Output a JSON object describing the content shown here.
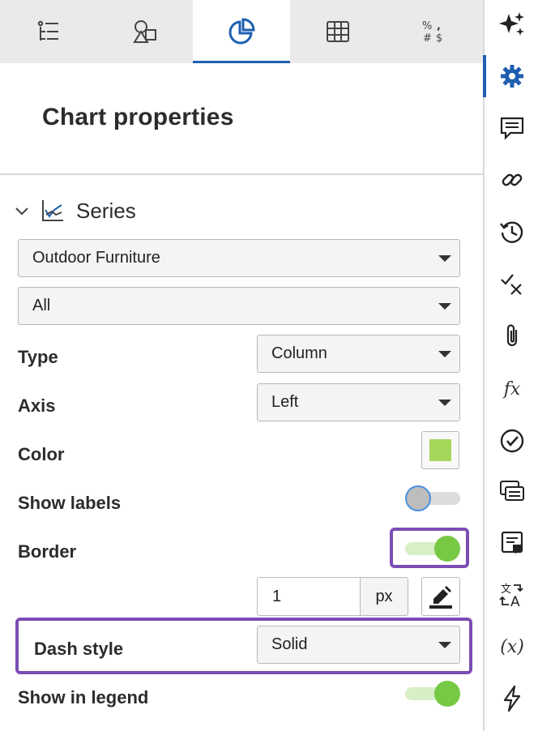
{
  "tabs": [
    {
      "name": "list-icon"
    },
    {
      "name": "shapes-icon"
    },
    {
      "name": "pie-chart-icon",
      "active": true
    },
    {
      "name": "table-icon"
    },
    {
      "name": "number-format-icon"
    }
  ],
  "panel": {
    "title": "Chart properties",
    "series_section": {
      "label": "Series",
      "series_select": "Outdoor Furniture",
      "points_select": "All"
    },
    "type": {
      "label": "Type",
      "value": "Column"
    },
    "axis": {
      "label": "Axis",
      "value": "Left"
    },
    "color": {
      "label": "Color",
      "value": "#a6d65a"
    },
    "show_labels": {
      "label": "Show labels",
      "on": false
    },
    "border": {
      "label": "Border",
      "on": true,
      "width": "1",
      "unit": "px"
    },
    "dash_style": {
      "label": "Dash style",
      "value": "Solid"
    },
    "show_in_legend": {
      "label": "Show in legend",
      "on": true
    }
  },
  "number_format_glyphs": "% &#8203;",
  "rail": {
    "fx_label": "fx",
    "var_label": "(x)"
  },
  "colors": {
    "accent": "#1f5fb0",
    "highlight": "#7c4db4",
    "toggle_on": "#77c944"
  }
}
